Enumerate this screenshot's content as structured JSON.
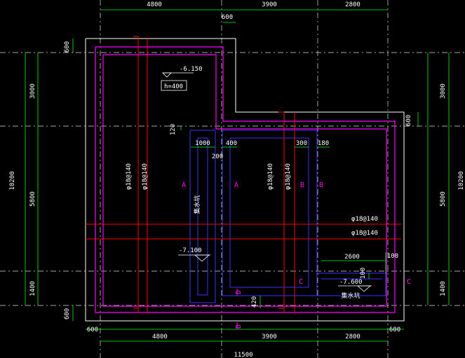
{
  "colors": {
    "background": "#000000",
    "dim": "#00ff00",
    "outline": "#ffffff",
    "magenta": "#ff00ff",
    "blue": "#3333ff",
    "red": "#ff0000",
    "label": "#ffffff"
  },
  "dims": {
    "top": [
      "4800",
      "3900",
      "2800"
    ],
    "top_notch": "600",
    "bottom": [
      "4800",
      "3900",
      "2800"
    ],
    "bottom_total": "11500",
    "bottom_left_edge": "600",
    "bottom_right_edge": "600",
    "left": [
      "3000",
      "5800",
      "1400"
    ],
    "left_total": "10200",
    "left_top": "600",
    "left_bottom": "600",
    "right": [
      "3000",
      "5800",
      "1400"
    ],
    "right_total": "10200",
    "right_step": "600"
  },
  "annotations": {
    "level_a": "-6.150",
    "thickness": "h=400",
    "level_b": "-7.100",
    "level_c": "-7.600",
    "pit_label_1": "集水坑",
    "pit_label_2": "集水坑",
    "dim_120": "120",
    "dim_1000": "1000",
    "dim_200": "200",
    "dim_400": "400",
    "dim_300": "300",
    "dim_180": "180",
    "dim_2600": "2600",
    "dim_100_a": "100",
    "dim_100_b": "100",
    "dim_420": "420"
  },
  "rebar": {
    "vertical_1": "φ18@140",
    "vertical_2": "φ18@140",
    "vertical_3": "φ18@140",
    "vertical_4": "φ18@140",
    "horizontal_1": "φ18@140",
    "horizontal_2": "φ18@140"
  },
  "sections": {
    "a_left": "A",
    "a_right": "A",
    "b_left": "B",
    "b_right": "B",
    "c_left": "C",
    "c_right": "C",
    "d_top": "D",
    "d_bottom": "D"
  }
}
